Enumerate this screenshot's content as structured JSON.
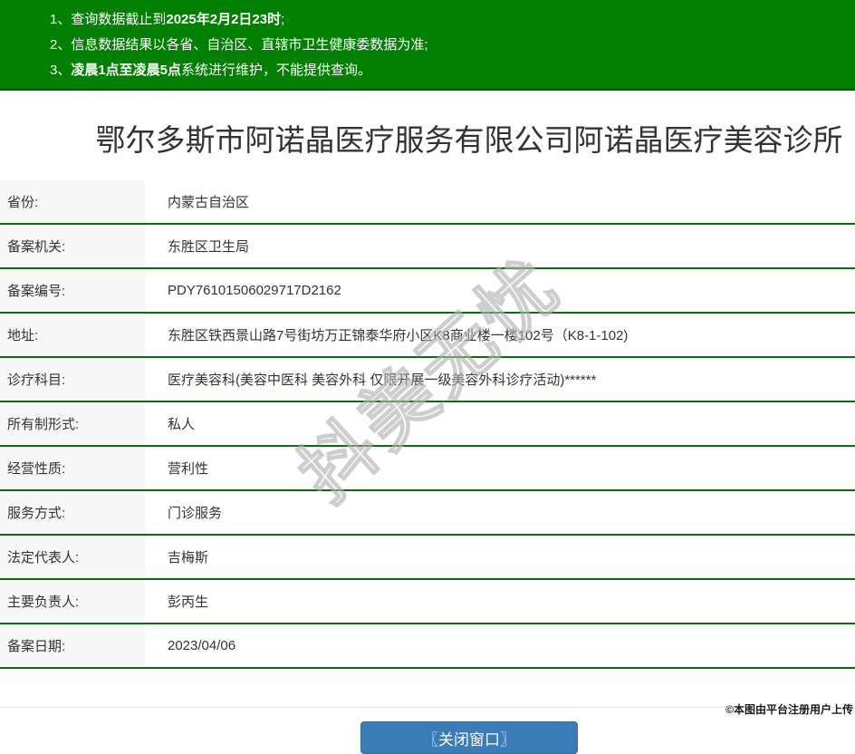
{
  "colors": {
    "header_green": "#028002",
    "row_border_green": "#0a6e0a",
    "label_cell_bg": "#f7f7f7",
    "button_blue": "#3a7cb8",
    "notice_text": "#ffffff"
  },
  "notices": {
    "items": [
      {
        "num": "1、",
        "pre": "查询数据截止到",
        "bold": "2025年2月2日23时",
        "post": ";"
      },
      {
        "num": "2、",
        "pre": "信息数据结果以各省、自治区、直辖市卫生健康委数据为准;",
        "bold": "",
        "post": ""
      },
      {
        "num": "3、",
        "pre": "",
        "bold": "凌晨1点至凌晨5点",
        "post": "系统进行维护，不能提供查询。"
      }
    ]
  },
  "title": "鄂尔多斯市阿诺晶医疗服务有限公司阿诺晶医疗美容诊所",
  "table": {
    "rows": [
      {
        "label": "省份:",
        "value": "内蒙古自治区"
      },
      {
        "label": "备案机关:",
        "value": "东胜区卫生局"
      },
      {
        "label": "备案编号:",
        "value": "PDY76101506029717D2162"
      },
      {
        "label": "地址:",
        "value": "东胜区铁西景山路7号街坊万正锦泰华府小区K8商业楼一楼102号（K8-1-102)"
      },
      {
        "label": "诊疗科目:",
        "value": "医疗美容科(美容中医科 美容外科 仅限开展一级美容外科诊疗活动)******"
      },
      {
        "label": "所有制形式:",
        "value": "私人"
      },
      {
        "label": "经营性质:",
        "value": "营利性"
      },
      {
        "label": "服务方式:",
        "value": "门诊服务"
      },
      {
        "label": "法定代表人:",
        "value": "吉梅斯"
      },
      {
        "label": "主要负责人:",
        "value": "彭丙生"
      },
      {
        "label": "备案日期:",
        "value": "2023/04/06"
      }
    ]
  },
  "button": {
    "close_label": "〖关闭窗口〗"
  },
  "watermark_text": "抖美无忧",
  "footer_credit": "©本图由平台注册用户上传"
}
